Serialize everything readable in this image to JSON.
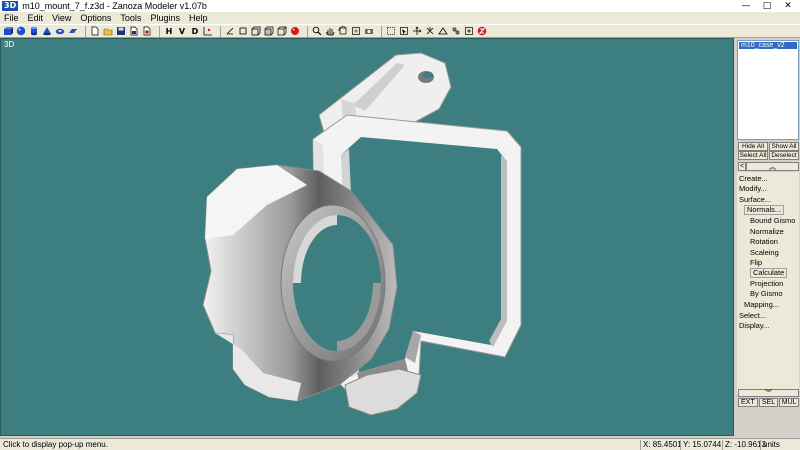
{
  "window": {
    "app_badge": "3D",
    "title": "m10_mount_7_f.z3d - Zanoza Modeler v1.07b",
    "min_glyph": "—",
    "max_glyph": "□",
    "close_glyph": "✕"
  },
  "menu": [
    {
      "label": "File"
    },
    {
      "label": "Edit"
    },
    {
      "label": "View"
    },
    {
      "label": "Options"
    },
    {
      "label": "Tools"
    },
    {
      "label": "Plugins"
    },
    {
      "label": "Help"
    }
  ],
  "toolbar": {
    "letters": [
      "H",
      "V",
      "D"
    ]
  },
  "viewport": {
    "label": "3D",
    "background": "#3d7f80"
  },
  "objects": {
    "items": [
      "m10_case_v2"
    ]
  },
  "panel": {
    "hide_all": "Hide All",
    "show_all": "Show All",
    "select_all": "Select All",
    "deselect": "Deselect",
    "nav_left": "<",
    "nav_up": "︽",
    "scroll_down": "︾",
    "ext": "EXT",
    "sel": "SEL",
    "mul": "MUL"
  },
  "commands": {
    "create": "Create...",
    "modify": "Modify...",
    "surface": "Surface...",
    "normals": "Normals...",
    "bound_gismo": "Bound Gismo",
    "normalize": "Normalize",
    "rotation": "Rotation",
    "scaleing": "Scaleing",
    "flip": "Flip",
    "calculate": "Calculate",
    "projection": "Projection",
    "by_gismo": "By Gismo",
    "mapping": "Mapping...",
    "select": "Select...",
    "display": "Display..."
  },
  "status": {
    "message": "Click to display pop-up menu.",
    "x": "X: 85.4501",
    "y": "Y: 15.0744",
    "z": "Z: -10.9613",
    "units": "units"
  }
}
